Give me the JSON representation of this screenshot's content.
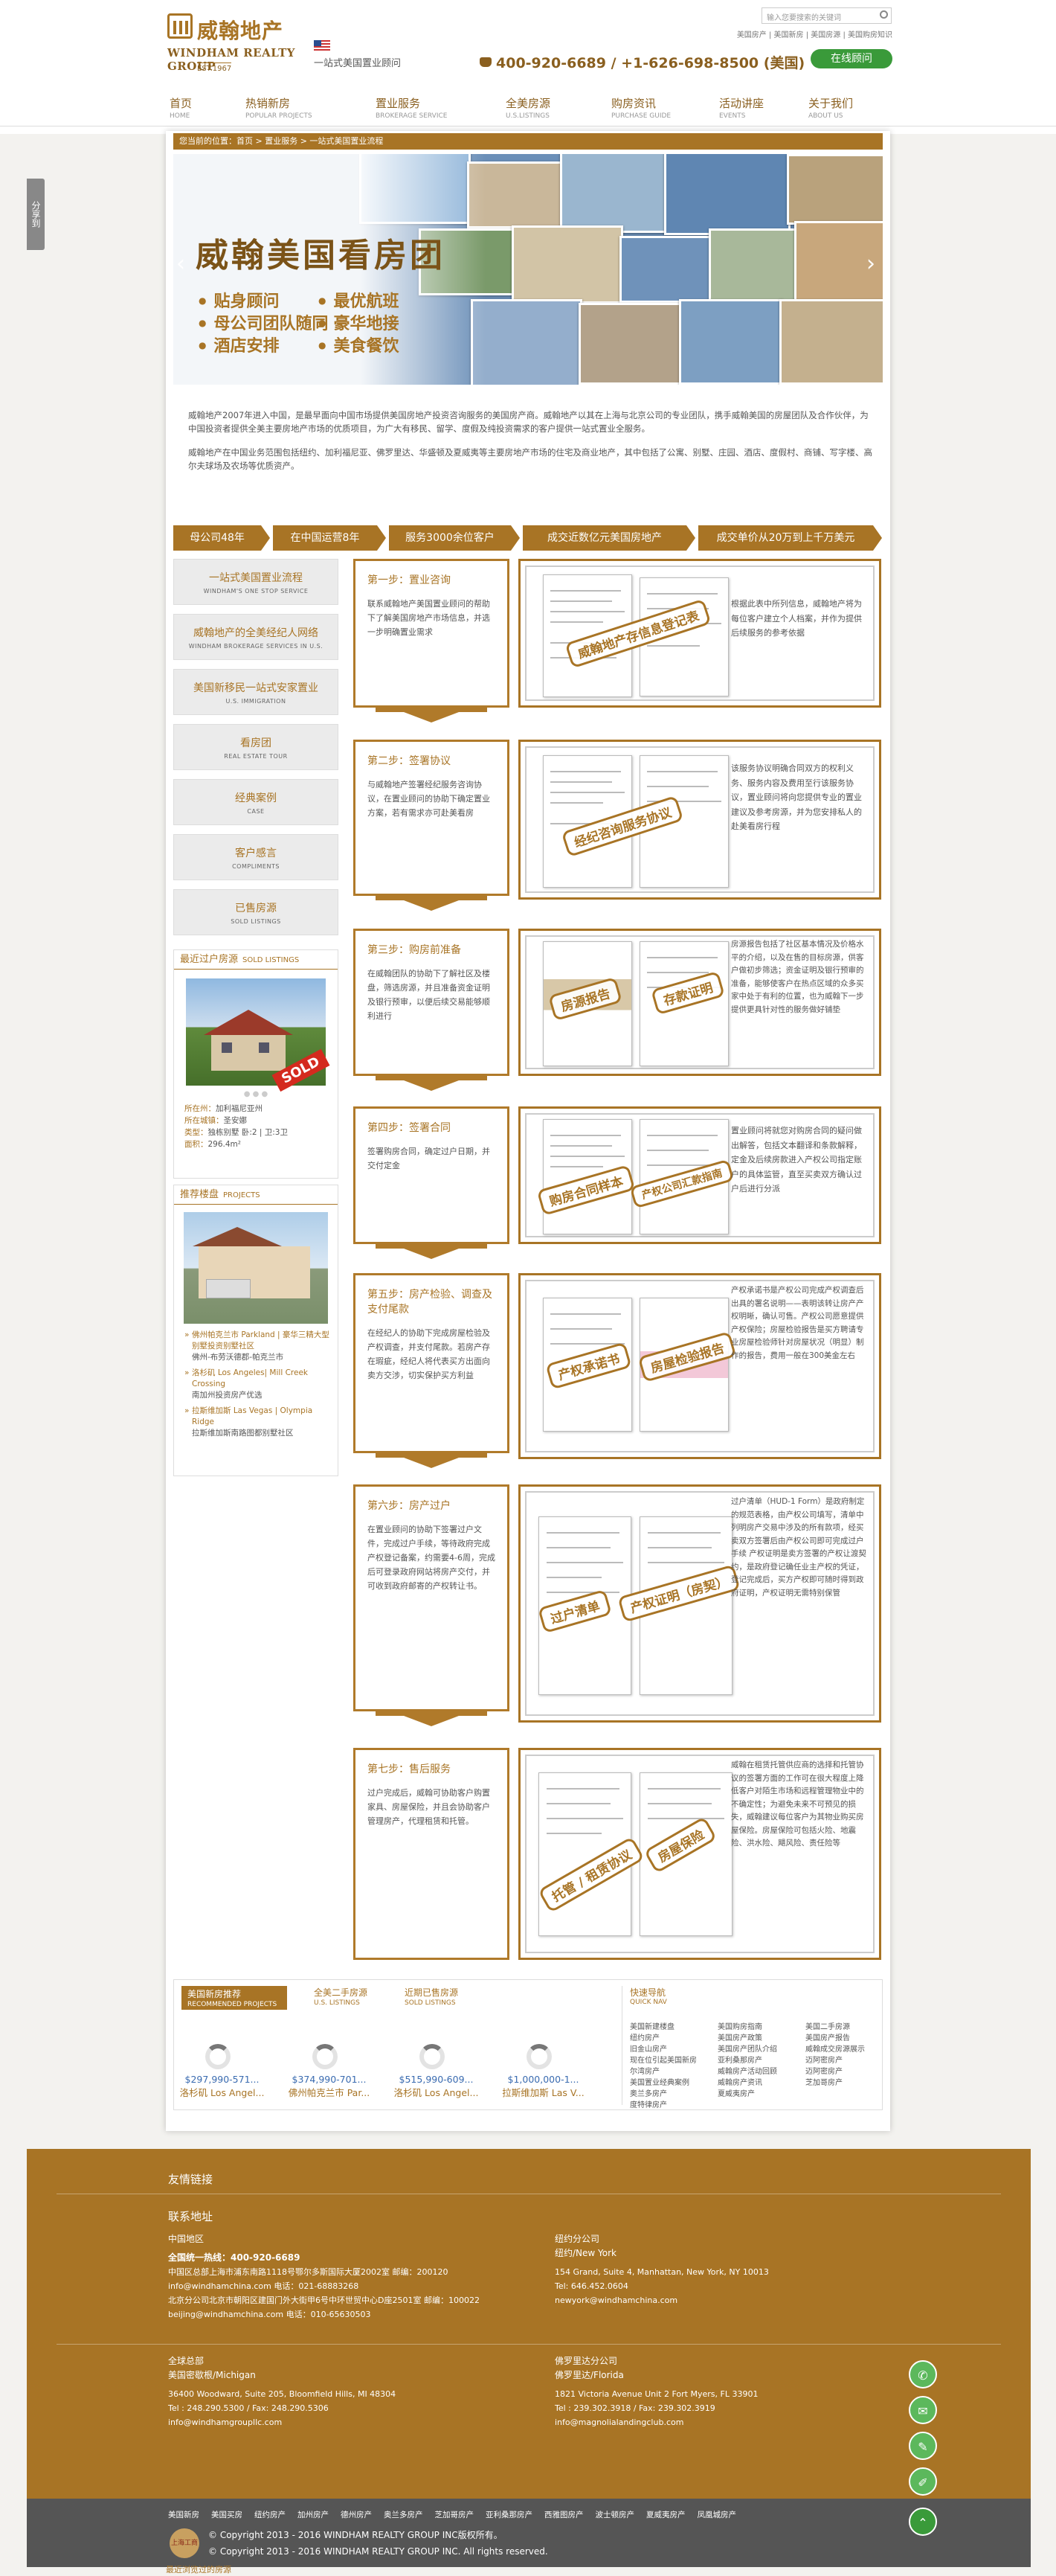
{
  "header": {
    "logo_cn": "威翰地产",
    "logo_en": "WINDHAM REALTY GROUP",
    "logo_est": "EST.1967",
    "slogan": "一站式美国置业顾问",
    "search_placeholder": "输入您要搜索的关键词",
    "top_links": "美国房产 | 美国新房 | 美国房源 | 美国购房知识",
    "phone": "400-920-6689 / +1-626-698-8500 (美国)",
    "chat_label": "在线顾问"
  },
  "nav": [
    {
      "cn": "首页",
      "en": "HOME"
    },
    {
      "cn": "热销新房",
      "en": "POPULAR PROJECTS"
    },
    {
      "cn": "置业服务",
      "en": "BROKERAGE SERVICE"
    },
    {
      "cn": "全美房源",
      "en": "U.S.LISTINGS"
    },
    {
      "cn": "购房资讯",
      "en": "PURCHASE GUIDE"
    },
    {
      "cn": "活动讲座",
      "en": "EVENTS"
    },
    {
      "cn": "关于我们",
      "en": "ABOUT US"
    }
  ],
  "side_tab": "分享到",
  "breadcrumb": "您当前的位置：首页 > 置业服务 > 一站式美国置业流程",
  "banner": {
    "title": "威翰美国看房团",
    "features": [
      "贴身顾问",
      "最优航班",
      "母公司团队随同",
      "豪华地接",
      "酒店安排",
      "美食餐饮"
    ]
  },
  "intro": [
    "威翰地产2007年进入中国，是最早面向中国市场提供美国房地产投资咨询服务的美国房产商。威翰地产以其在上海与北京公司的专业团队，携手威翰美国的房屋团队及合作伙伴，为中国投资者提供全美主要房地产市场的优质项目，为广大有移民、留学、度假及纯投资需求的客户提供一站式置业全服务。",
    "威翰地产在中国业务范围包括纽约、加利福尼亚、佛罗里达、华盛顿及夏威夷等主要房地产市场的住宅及商业地产，其中包括了公寓、别墅、庄园、酒店、度假村、商铺、写字楼、高尔夫球场及农场等优质资产。"
  ],
  "stats": [
    "母公司48年",
    "在中国运营8年",
    "服务3000余位客户",
    "成交近数亿元美国房地产",
    "成交单价从20万到上千万美元"
  ],
  "left_nav": [
    {
      "cn": "一站式美国置业流程",
      "en": "WINDHAM'S ONE STOP SERVICE"
    },
    {
      "cn": "威翰地产的全美经纪人网络",
      "en": "WINDHAM BROKERAGE SERVICES IN U.S."
    },
    {
      "cn": "美国新移民一站式安家置业",
      "en": "U.S. IMMIGRATION"
    },
    {
      "cn": "看房团",
      "en": "REAL ESTATE TOUR"
    },
    {
      "cn": "经典案例",
      "en": "CASE"
    },
    {
      "cn": "客户感言",
      "en": "COMPLIMENTS"
    },
    {
      "cn": "已售房源",
      "en": "SOLD LISTINGS"
    }
  ],
  "sold": {
    "title": "最近过户房源",
    "title_en": "SOLD LISTINGS",
    "badge": "SOLD",
    "dots": "● ● ●",
    "location_label": "所在州：",
    "location": "加利福尼亚州",
    "city_label": "所在城镇：",
    "city": "圣安娜",
    "type_label": "类型：",
    "type": "独栋别墅 卧:2 | 卫:3卫",
    "area_label": "面积：",
    "area": "296.4m²"
  },
  "projects": {
    "title": "推荐楼盘",
    "title_en": "PROJECTS",
    "items": [
      {
        "link": "佛州帕克兰市 Parkland | 豪华三精大型别墅投资别墅社区",
        "sub": "佛州-布劳沃德郡-帕克兰市"
      },
      {
        "link": "洛杉矶 Los Angeles| Mill Creek Crossing",
        "sub": "南加州投资房产优选"
      },
      {
        "link": "拉斯维加斯 Las Vegas | Olympia Ridge",
        "sub": "拉斯维加斯南路图都别墅社区"
      }
    ]
  },
  "steps": [
    {
      "title": "第一步：置业咨询",
      "desc": "联系威翰地产美国置业顾问的帮助下了解美国房地产市场信息，并选一步明确置业需求",
      "stamps": [
        "威翰地产存信息登记表"
      ],
      "text": "根据此表中所列信息，威翰地产将为每位客户建立个人档案，并作为提供后续服务的参考依据"
    },
    {
      "title": "第二步：签署协议",
      "desc": "与威翰地产签署经纪服务咨询协议，在置业顾问的协助下确定置业方案，若有需求亦可赴美看房",
      "stamps": [
        "经纪咨询服务协议"
      ],
      "text": "该服务协议明确合同双方的权利义务、服务内容及费用至行该服务协议，置业顾问将向您提供专业的置业建议及参考房源，并为您安排私人的赴美看房行程"
    },
    {
      "title": "第三步：购房前准备",
      "desc": "在威翰团队的协助下了解社区及楼盘，筛选房源，并且准备资金证明及银行预审，以便后续交易能够顺利进行",
      "stamps": [
        "房源报告",
        "存款证明"
      ],
      "text": "房源报告包括了社区基本情况及价格水平的介绍，以及在售的目标房源，供客户做初步筛选；资金证明及银行预审的准备，能够使客户在热点区域的众多买家中处于有利的位置，也为威翰下一步提供更具针对性的服务做好铺垫"
    },
    {
      "title": "第四步：签署合同",
      "desc": "签署购房合同，确定过户日期，并交付定金",
      "stamps": [
        "购房合同样本",
        "产权公司汇款指南"
      ],
      "text": "置业顾问将就您对购房合同的疑问做出解答，包括文本翻译和条款解释，定金及后续房款进入产权公司指定账户的具体监管，直至买卖双方确认过户后进行分派"
    },
    {
      "title": "第五步：房产检验、调查及支付尾款",
      "desc": "在经纪人的协助下完成房屋检验及产权调查，并支付尾款。若房产存在瑕疵，经纪人将代表买方出面向卖方交涉，切实保护买方利益",
      "stamps": [
        "产权承诺书",
        "房屋检验报告"
      ],
      "text": "产权承诺书是产权公司完成产权调查后出具的署名说明——表明该转让房产产权明晰，确认可售。产权公司愿意提供产权保险；房屋检验报告是买方聘请专业房屋检验师针对房屋状况（明显）制作的报告，费用一般在300美金左右"
    },
    {
      "title": "第六步：房产过户",
      "desc": "在置业顾问的协助下签署过户文件，完成过户手续，等待政府完成产权登记备案，约需要4-6周，完成后可登录政府网站将房产交付，并可收到政府邮寄的产权转让书。",
      "stamps": [
        "过户清单",
        "产权证明（房契）"
      ],
      "text": "过户清单（HUD-1 Form）是政府制定的规范表格，由产权公司填写，清单中列明房产交易中涉及的所有款项，经买卖双方签署后由产权公司即可完成过户手续 产权证明是卖方签署的产权让渡契约，是政府登记确任业主产权的凭证，登记完成后，买方产权即可随时得到政府证明，产权证明无需特别保管"
    },
    {
      "title": "第七步：售后服务",
      "desc": "过户完成后，威翰可协助客户购置家具、房屋保险，并且会协助客户管理房产，代理租赁和托管。",
      "stamps": [
        "托管 / 租赁协议",
        "房屋保险"
      ],
      "text": "威翰在租赁托管供应商的选择和托管协议的签署方面的工作可在很大程度上降低客户对陌生市场和远程管理物业中的不确定性；为避免未来不可预见的损失，威翰建议每位客户为其物业购买房屋保险。房屋保险可包括火险、地震险、洪水险、飓风险、责任险等"
    }
  ],
  "bottom": {
    "tabs": [
      {
        "cn": "美国新房推荐",
        "en": "RECOMMENDED PROJECTS"
      },
      {
        "cn": "全美二手房源",
        "en": "U.S. LISTINGS"
      },
      {
        "cn": "近期已售房源",
        "en": "SOLD LISTINGS"
      }
    ],
    "cards": [
      {
        "price": "$297,990-571...",
        "addr": "洛杉矶 Los Angel..."
      },
      {
        "price": "$374,990-701...",
        "addr": "佛州帕克兰市 Par..."
      },
      {
        "price": "$515,990-609...",
        "addr": "洛杉矶 Los Angel..."
      },
      {
        "price": "$1,000,000-1...",
        "addr": "拉斯维加斯 Las V..."
      }
    ],
    "quicknav_title": "快速导航",
    "quicknav_en": "QUICK NAV",
    "quicknav_cols": [
      [
        "美国新建楼盘",
        "纽约房产",
        "旧金山房产",
        "现在位引起美国新房",
        "尔湾房产",
        "美国置业经典案例",
        "奥兰多房产",
        "度特律房产"
      ],
      [
        "美国购房指南",
        "美国房产政策",
        "美国房产团队介绍",
        "亚利桑那房产",
        "威翰房产活动回顾",
        "威翰房产资讯",
        "夏威夷房产"
      ],
      [
        "美国二手房源",
        "美国房产报告",
        "威翰成交房源展示",
        "迈阿密房产",
        "迈阿密房产",
        "芝加哥房产"
      ]
    ]
  },
  "footer": {
    "friend_links": "友情链接",
    "contact": "联系地址",
    "china": "中国地区",
    "hotline": "全国统一热线：400-920-6689",
    "sh": "中国区总部上海市浦东南路1118号鄂尔多斯国际大厦2002室 邮编：200120",
    "sh_mail": "info@windhamchina.com 电话：021-68883268",
    "bj": "北京分公司北京市朝阳区建国门外大街甲6号中环世贸中心D座2501室 邮编：100022",
    "bj_mail": "beijing@windhamchina.com 电话：010-65630503",
    "ny_head": "纽约分公司",
    "ny_en": "纽约/New York",
    "ny_addr": "154 Grand, Suite 4, Manhattan, New York, NY 10013",
    "ny_tel": "Tel: 646.452.0604",
    "ny_mail": "newyork@windhamchina.com",
    "global": "全球总部",
    "mi_en": "美国密歇根/Michigan",
    "mi_addr": "36400 Woodward, Suite 205, Bloomfield Hills, MI 48304",
    "mi_tel": "Tel : 248.290.5300 / Fax: 248.290.5306",
    "mi_mail": "info@windhamgroupllc.com",
    "fl_head": "佛罗里达分公司",
    "fl_en": "佛罗里达/Florida",
    "fl_addr": "1821 Victoria Avenue Unit 2 Fort Myers, FL 33901",
    "fl_tel": "Tel : 239.302.3918 / Fax: 239.302.3919",
    "fl_mail": "info@magnolialandingclub.com",
    "links": [
      "美国新房",
      "美国买房",
      "纽约房产",
      "加州房产",
      "德州房产",
      "奥兰多房产",
      "芝加哥房产",
      "亚利桑那房产",
      "西雅图房产",
      "波士顿房产",
      "夏威夷房产",
      "凤凰城房产"
    ],
    "copy1": "© Copyright 2013 - 2016 WINDHAM REALTY GROUP INC版权所有。",
    "copy2": "© Copyright 2013 - 2016 WINDHAM REALTY GROUP INC. All rights reserved.",
    "badge": "上海工商",
    "recent": "最近浏览过的房源"
  },
  "colors": {
    "brand": "#a87425",
    "green": "#5cb85c",
    "footer_dark": "#555555"
  }
}
